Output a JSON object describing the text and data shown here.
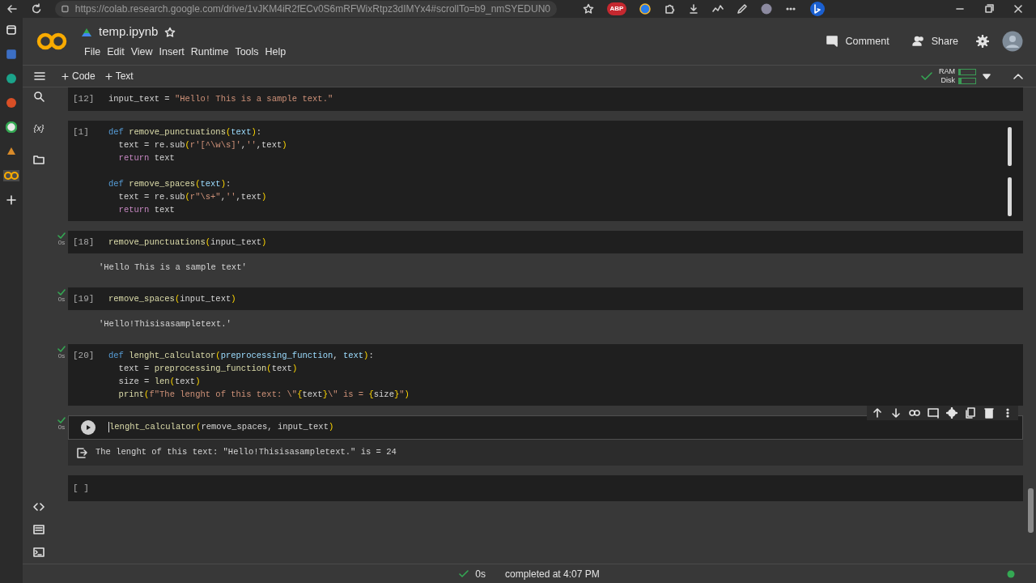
{
  "browser": {
    "url": "https://colab.research.google.com/drive/1vJKM4iR2fECv0S6mRFWixRtpz3dIMYx4#scrollTo=b9_nmSYEDUN0",
    "extension_badge": "ABP"
  },
  "header": {
    "title": "temp.ipynb",
    "starred": false,
    "menu": [
      "File",
      "Edit",
      "View",
      "Insert",
      "Runtime",
      "Tools",
      "Help"
    ],
    "actions": [
      "Comment",
      "Share"
    ]
  },
  "sidebar": {
    "variables_label": "{x}"
  },
  "toolbar": {
    "add_buttons": [
      "Code",
      "Text"
    ],
    "connected": true,
    "resources": [
      {
        "label": "RAM",
        "level": 0.1
      },
      {
        "label": "Disk",
        "level": 0.15
      }
    ]
  },
  "cells": [
    {
      "exec": "[12]",
      "ran": false,
      "selected": false,
      "blocks": [
        [
          [
            {
              "kind": "plain",
              "text": "input_text = "
            },
            {
              "kind": "str",
              "text": "\"Hello! This is a sample text.\""
            }
          ]
        ]
      ]
    },
    {
      "exec": "[1]",
      "ran": false,
      "selected": false,
      "blocks": [
        [
          [
            {
              "kind": "kw",
              "text": "def "
            },
            {
              "kind": "fn",
              "text": "remove_punctuations"
            },
            {
              "kind": "brace",
              "text": "("
            },
            {
              "kind": "param",
              "text": "text"
            },
            {
              "kind": "brace",
              "text": ")"
            },
            {
              "kind": "plain",
              "text": ":"
            }
          ],
          [
            {
              "kind": "plain",
              "text": "  text = re.sub"
            },
            {
              "kind": "brace",
              "text": "("
            },
            {
              "kind": "str",
              "text": "r'[^\\w\\s]'"
            },
            {
              "kind": "plain",
              "text": ","
            },
            {
              "kind": "str",
              "text": "''"
            },
            {
              "kind": "plain",
              "text": ",text"
            },
            {
              "kind": "brace",
              "text": ")"
            }
          ],
          [
            {
              "kind": "ret",
              "text": "  return "
            },
            {
              "kind": "plain",
              "text": "text"
            }
          ]
        ],
        [
          [
            {
              "kind": "kw",
              "text": "def "
            },
            {
              "kind": "fn",
              "text": "remove_spaces"
            },
            {
              "kind": "brace",
              "text": "("
            },
            {
              "kind": "param",
              "text": "text"
            },
            {
              "kind": "brace",
              "text": ")"
            },
            {
              "kind": "plain",
              "text": ":"
            }
          ],
          [
            {
              "kind": "plain",
              "text": "  text = re.sub"
            },
            {
              "kind": "brace",
              "text": "("
            },
            {
              "kind": "str",
              "text": "r\"\\s+\""
            },
            {
              "kind": "plain",
              "text": ","
            },
            {
              "kind": "str",
              "text": "''"
            },
            {
              "kind": "plain",
              "text": ",text"
            },
            {
              "kind": "brace",
              "text": ")"
            }
          ],
          [
            {
              "kind": "ret",
              "text": "  return "
            },
            {
              "kind": "plain",
              "text": "text"
            }
          ]
        ]
      ]
    },
    {
      "exec": "[18]",
      "ran": true,
      "run_time": "0s",
      "selected": false,
      "blocks": [
        [
          [
            {
              "kind": "fn",
              "text": "remove_punctuations"
            },
            {
              "kind": "brace",
              "text": "("
            },
            {
              "kind": "plain",
              "text": "input_text"
            },
            {
              "kind": "brace",
              "text": ")"
            }
          ]
        ]
      ],
      "output": {
        "kind": "result",
        "text": "'Hello This is a sample text'"
      }
    },
    {
      "exec": "[19]",
      "ran": true,
      "run_time": "0s",
      "selected": false,
      "blocks": [
        [
          [
            {
              "kind": "fn",
              "text": "remove_spaces"
            },
            {
              "kind": "brace",
              "text": "("
            },
            {
              "kind": "plain",
              "text": "input_text"
            },
            {
              "kind": "brace",
              "text": ")"
            }
          ]
        ]
      ],
      "output": {
        "kind": "result",
        "text": "'Hello!Thisisasampletext.'"
      }
    },
    {
      "exec": "[20]",
      "ran": true,
      "run_time": "0s",
      "selected": false,
      "blocks": [
        [
          [
            {
              "kind": "kw",
              "text": "def "
            },
            {
              "kind": "fn",
              "text": "lenght_calculator"
            },
            {
              "kind": "brace",
              "text": "("
            },
            {
              "kind": "param",
              "text": "preprocessing_function"
            },
            {
              "kind": "plain",
              "text": ", "
            },
            {
              "kind": "param",
              "text": "text"
            },
            {
              "kind": "brace",
              "text": ")"
            },
            {
              "kind": "plain",
              "text": ":"
            }
          ],
          [
            {
              "kind": "plain",
              "text": "  text = "
            },
            {
              "kind": "fn",
              "text": "preprocessing_function"
            },
            {
              "kind": "brace",
              "text": "("
            },
            {
              "kind": "plain",
              "text": "text"
            },
            {
              "kind": "brace",
              "text": ")"
            }
          ],
          [
            {
              "kind": "plain",
              "text": "  size = "
            },
            {
              "kind": "fn",
              "text": "len"
            },
            {
              "kind": "brace",
              "text": "("
            },
            {
              "kind": "plain",
              "text": "text"
            },
            {
              "kind": "brace",
              "text": ")"
            }
          ],
          [
            {
              "kind": "fn",
              "text": "  print"
            },
            {
              "kind": "brace",
              "text": "("
            },
            {
              "kind": "str",
              "text": "f\"The lenght of this text: \\\""
            },
            {
              "kind": "brace",
              "text": "{"
            },
            {
              "kind": "plain",
              "text": "text"
            },
            {
              "kind": "brace",
              "text": "}"
            },
            {
              "kind": "str",
              "text": "\\\" is = "
            },
            {
              "kind": "brace",
              "text": "{"
            },
            {
              "kind": "plain",
              "text": "size"
            },
            {
              "kind": "brace",
              "text": "}"
            },
            {
              "kind": "str",
              "text": "\""
            },
            {
              "kind": "brace",
              "text": ")"
            }
          ]
        ]
      ]
    },
    {
      "ran": true,
      "run_time": "0s",
      "selected": true,
      "blocks": [
        [
          [
            {
              "kind": "fn",
              "text": "lenght_calculator"
            },
            {
              "kind": "brace",
              "text": "("
            },
            {
              "kind": "plain",
              "text": "remove_spaces, input_text"
            },
            {
              "kind": "brace",
              "text": ")"
            }
          ]
        ]
      ],
      "output": {
        "kind": "stdout",
        "text": "The lenght of this text: \"Hello!Thisisasampletext.\" is = 24"
      }
    },
    {
      "exec": "[ ]",
      "ran": false,
      "selected": false
    }
  ],
  "status_bar": {
    "ran": true,
    "time": "0s",
    "text": "completed at 4:07 PM",
    "connected": true
  }
}
